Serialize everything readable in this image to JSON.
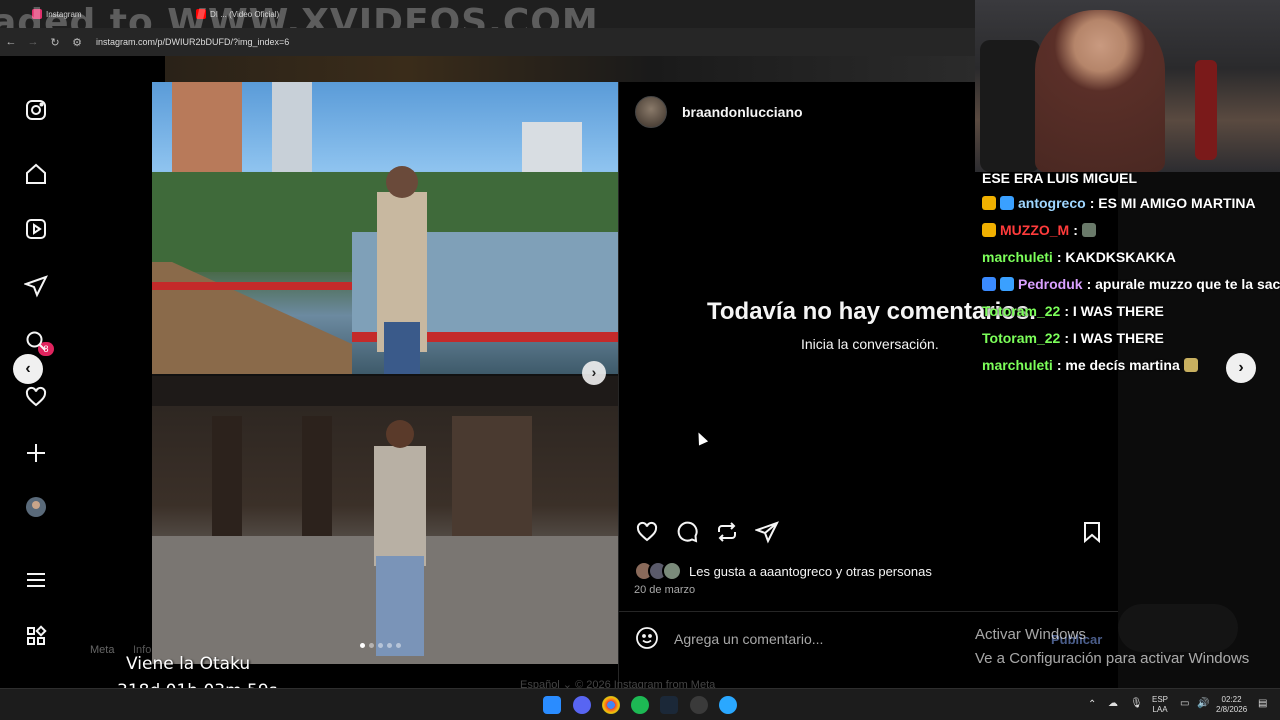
{
  "browser": {
    "tabs": [
      {
        "label": "Instagram",
        "color": "#e1306c"
      },
      {
        "label": "DI ... (Video Oficial)",
        "color": "#ff0000"
      }
    ],
    "watermark": "aded to WWW.XVIDEOS.COM",
    "url": "instagram.com/p/DWIUR2bDUFD/?img_index=6"
  },
  "sidebar": {
    "items": [
      {
        "icon": "instagram-icon"
      },
      {
        "icon": "home-icon"
      },
      {
        "icon": "reels-icon"
      },
      {
        "icon": "messages-icon"
      },
      {
        "icon": "search-icon"
      },
      {
        "icon": "notifications-icon"
      },
      {
        "icon": "create-icon"
      },
      {
        "icon": "profile-icon"
      },
      {
        "icon": "menu-icon"
      },
      {
        "icon": "apps-icon"
      }
    ],
    "messages_badge": "8",
    "meta": "Meta",
    "info": "Info"
  },
  "post": {
    "username": "braandonlucciano",
    "no_comments": "Todavía no hay comentarios.",
    "start_conversation": "Inicia la conversación.",
    "likes_text": "Les gusta a aaantogreco y otras personas",
    "date": "20 de marzo",
    "comment_placeholder": "Agrega un comentario...",
    "publish": "Publicar",
    "slide_count": 5,
    "active_slide": 1
  },
  "footer": "Español ⌄   © 2026 Instagram from Meta",
  "chat": [
    {
      "name": "",
      "message": "ESE ERA LUIS MIGUEL",
      "color": "#ffffff"
    },
    {
      "name": "antogreco",
      "message": " : ES MI AMIGO MARTINA",
      "color": "#9fd6ff"
    },
    {
      "name": "MUZZO_M",
      "message": " : ",
      "color": "#ff3b3b"
    },
    {
      "name": "marchuleti",
      "message": " : KAKDKSKAKKA",
      "color": "#7cff5a"
    },
    {
      "name": "Pedroduk",
      "message": " : apurale muzzo que te la sac",
      "color": "#d9a0ff"
    },
    {
      "name": "Totoram_22",
      "message": " : I WAS THERE",
      "color": "#7cff5a"
    },
    {
      "name": "Totoram_22",
      "message": " : I WAS THERE",
      "color": "#7cff5a"
    },
    {
      "name": "marchuleti",
      "message": " : me decís martina",
      "color": "#7cff5a"
    }
  ],
  "windows": {
    "activate_title": "Activar Windows",
    "activate_sub": "Ve a Configuración para activar Windows"
  },
  "stream": {
    "title": "Viene la Otaku",
    "timer": "318d 01h 03m 59s"
  },
  "taskbar": {
    "lang1": "ESP",
    "lang2": "LAA",
    "time": "02:22",
    "date": "2/8/2026"
  }
}
